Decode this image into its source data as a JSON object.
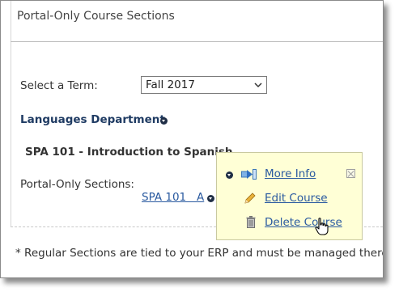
{
  "panel": {
    "title": "Portal-Only Course Sections"
  },
  "term": {
    "label": "Select a Term:",
    "selected": "Fall 2017"
  },
  "department": {
    "name": "Languages Department"
  },
  "course": {
    "title": "SPA 101 - Introduction to Spanish",
    "sections_label": "Portal-Only Sections:",
    "section_link": "SPA 101   A"
  },
  "popup": {
    "more_info": "More Info",
    "edit_course": "Edit Course",
    "delete_course": "Delete Course"
  },
  "footnote": "* Regular Sections are tied to your ERP and must be managed there.",
  "colors": {
    "link": "#2a5aa0",
    "department": "#1f3b63",
    "popup_bg": "#ffffd6"
  }
}
